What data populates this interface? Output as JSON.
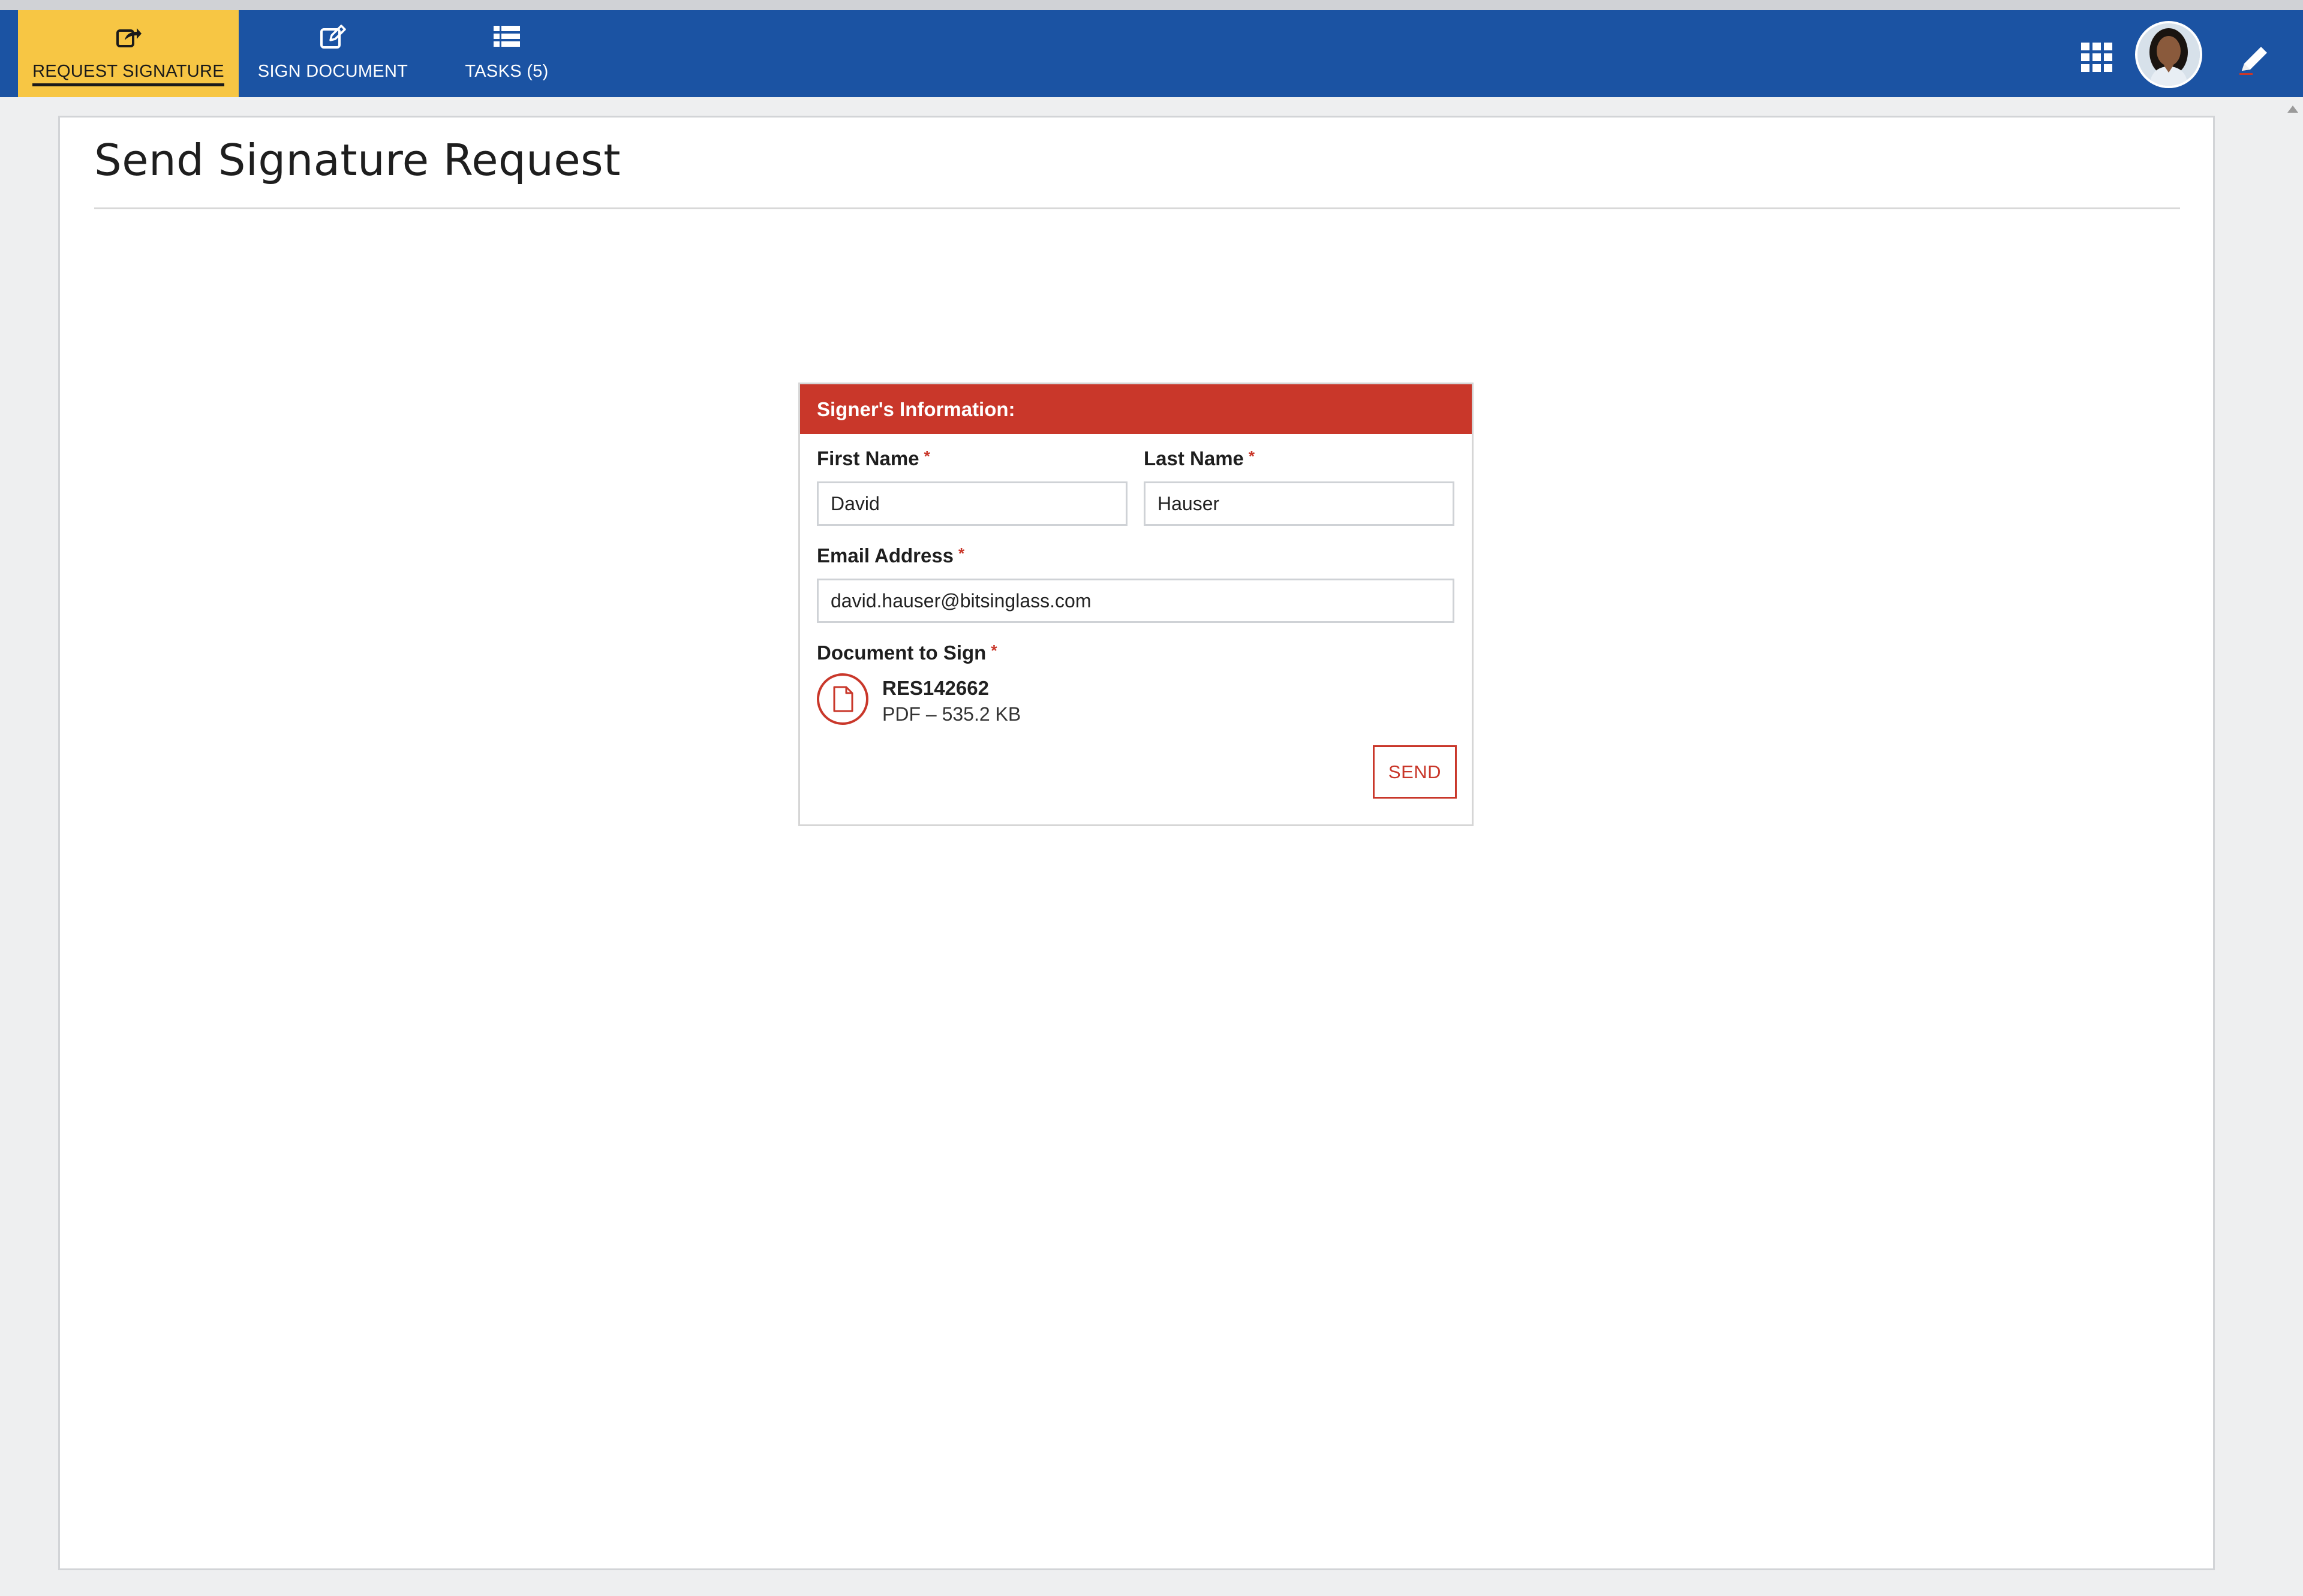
{
  "nav": {
    "items": [
      {
        "label": "REQUEST SIGNATURE",
        "icon": "share-icon",
        "active": true
      },
      {
        "label": "SIGN DOCUMENT",
        "icon": "edit-icon",
        "active": false
      },
      {
        "label": "TASKS (5)",
        "icon": "list-icon",
        "active": false
      }
    ],
    "right_icons": [
      "apps-grid-icon",
      "avatar",
      "pencil-icon"
    ]
  },
  "page": {
    "title": "Send Signature Request"
  },
  "signer_form": {
    "header": "Signer's Information:",
    "required_marker": "*",
    "first_name": {
      "label": "First Name",
      "value": "David"
    },
    "last_name": {
      "label": "Last Name",
      "value": "Hauser"
    },
    "email": {
      "label": "Email Address",
      "value": "david.hauser@bitsinglass.com"
    },
    "document": {
      "label": "Document to Sign",
      "name": "RES142662",
      "meta": "PDF – 535.2 KB",
      "icon": "document-icon"
    },
    "send_label": "SEND"
  },
  "colors": {
    "nav_bg": "#1b53a3",
    "nav_active": "#f7c644",
    "accent": "#c9372a"
  }
}
